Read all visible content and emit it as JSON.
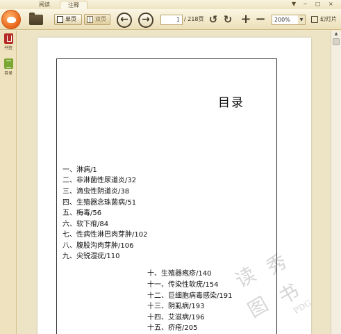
{
  "tabs": [
    {
      "label": "阅读"
    },
    {
      "label": "注释"
    }
  ],
  "window_controls": {
    "menu": "▼",
    "minimize": "‒",
    "maximize": "□",
    "close": "×"
  },
  "toolbar": {
    "single_page": "单页",
    "double_page": "双页",
    "prev_symbol": "←",
    "next_symbol": "→",
    "current_page": "1",
    "total_pages": "/ 218页",
    "rotate_left_symbol": "↺",
    "rotate_right_symbol": "↻",
    "zoom_in_symbol": "+",
    "zoom_out_symbol": "−",
    "zoom_level": "200%",
    "slideshow": "幻灯片"
  },
  "sidebar": {
    "items": [
      {
        "label": "书签",
        "icon": "bookmark-icon"
      },
      {
        "label": "目录",
        "icon": "toc-icon"
      }
    ]
  },
  "document": {
    "title": "目录",
    "entries": [
      "一、淋病/1",
      "二、非淋菌性尿道炎/32",
      "三、滴虫性阴道炎/38",
      "四、生殖器念珠菌病/51",
      "五、梅毒/56",
      "六、软下疳/84",
      "七、性病性淋巴肉芽肿/102",
      "八、腹股沟肉芽肿/106",
      "九、尖锐湿疣/110",
      "十、生殖器疱疹/140",
      "十一、传染性软疣/154",
      "十二、巨细胞病毒感染/191",
      "十三、阴虱病/193",
      "十四、艾滋病/196",
      "十五、疥疮/205"
    ],
    "watermark_chars": [
      "读",
      "秀",
      "图",
      "书",
      "PDG"
    ]
  },
  "colors": {
    "chrome_bg": "#f2e9cc",
    "page_bg": "#ffffff",
    "accent_orange": "#e8641b"
  }
}
